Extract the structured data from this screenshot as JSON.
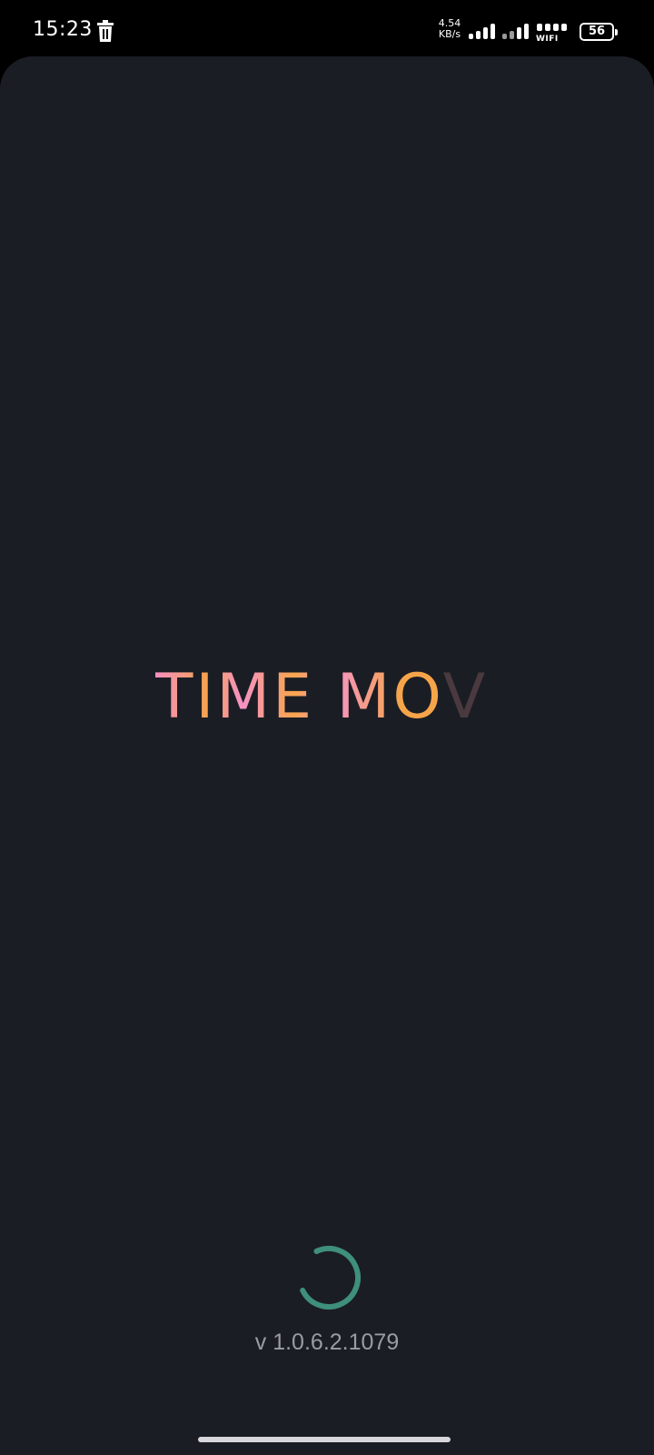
{
  "status_bar": {
    "time": "15:23",
    "net_speed_value": "4.54",
    "net_speed_unit": "KB/s",
    "wifi_label": "WIFI",
    "battery_level": "56",
    "icons": [
      "trash-icon",
      "signal-icon",
      "signal-icon",
      "wifi-icon",
      "battery-icon"
    ]
  },
  "splash": {
    "logo_main": "TIME MO",
    "logo_fade": "V",
    "version": "v 1.0.6.2.1079",
    "spinner_color": "#3e8f7c"
  },
  "colors": {
    "background": "#1b1d24",
    "logo_pink": "#f58fc1",
    "logo_orange": "#f6a24e",
    "version_text": "#9a9ca3"
  }
}
